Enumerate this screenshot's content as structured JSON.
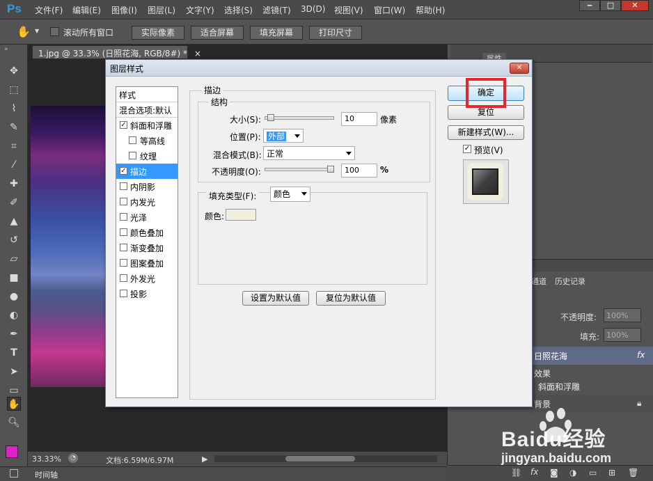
{
  "app": {
    "logo": "Ps"
  },
  "menu": [
    "文件(F)",
    "编辑(E)",
    "图像(I)",
    "图层(L)",
    "文字(Y)",
    "选择(S)",
    "滤镜(T)",
    "3D(D)",
    "视图(V)",
    "窗口(W)",
    "帮助(H)"
  ],
  "options": {
    "scroll_all_label": "滚动所有窗口",
    "buttons": [
      "实际像素",
      "适合屏幕",
      "填充屏幕",
      "打印尺寸"
    ]
  },
  "document": {
    "tab_title": "1.jpg @ 33.3% (日照花海, RGB/8#) *",
    "zoom": "33.33%",
    "doc_size": "文档:6.59M/6.97M"
  },
  "timeline_label": "时间轴",
  "right_panel": {
    "panel_tab_top": "属性",
    "tab_channels_partial": "通道",
    "tab_history": "历史记录",
    "opacity_label": "不透明度:",
    "opacity_value": "100%",
    "fill_label": "填充:",
    "fill_value": "100%",
    "layer_name": "日照花海",
    "fx_label": "fx",
    "effects_label": "效果",
    "effect_bevel": "斜面和浮雕",
    "background_label": "背景"
  },
  "dialog": {
    "title": "图层样式",
    "styles_header": "样式",
    "blend_options": "混合选项:默认",
    "style_items": [
      {
        "label": "斜面和浮雕",
        "checked": true,
        "indent": false
      },
      {
        "label": "等高线",
        "checked": false,
        "indent": true
      },
      {
        "label": "纹理",
        "checked": false,
        "indent": true
      },
      {
        "label": "描边",
        "checked": true,
        "indent": false,
        "selected": true
      },
      {
        "label": "内阴影",
        "checked": false,
        "indent": false
      },
      {
        "label": "内发光",
        "checked": false,
        "indent": false
      },
      {
        "label": "光泽",
        "checked": false,
        "indent": false
      },
      {
        "label": "颜色叠加",
        "checked": false,
        "indent": false
      },
      {
        "label": "渐变叠加",
        "checked": false,
        "indent": false
      },
      {
        "label": "图案叠加",
        "checked": false,
        "indent": false
      },
      {
        "label": "外发光",
        "checked": false,
        "indent": false
      },
      {
        "label": "投影",
        "checked": false,
        "indent": false
      }
    ],
    "section_title": "描边",
    "structure_title": "结构",
    "size_label": "大小(S):",
    "size_value": "10",
    "size_unit": "像素",
    "size_fraction": 0.04,
    "position_label": "位置(P):",
    "position_value": "外部",
    "blend_mode_label": "混合模式(B):",
    "blend_mode_value": "正常",
    "opacity_label": "不透明度(O):",
    "opacity_value": "100",
    "opacity_unit": "%",
    "opacity_fraction": 1.0,
    "fill_type_label": "填充类型(F):",
    "fill_type_value": "颜色",
    "color_label": "颜色:",
    "stroke_color": "#f1efdd",
    "btn_set_default": "设置为默认值",
    "btn_reset_default": "复位为默认值",
    "btn_ok": "确定",
    "btn_reset": "复位",
    "btn_new_style": "新建样式(W)...",
    "preview_label": "预览(V)",
    "preview_checked": true
  },
  "colors": {
    "foreground": "#e020c8",
    "background": "#ffffff",
    "highlight": "#e8252d",
    "selection": "#3399ff"
  },
  "watermark": {
    "brand": "Baidu经验",
    "url": "jingyan.baidu.com"
  }
}
